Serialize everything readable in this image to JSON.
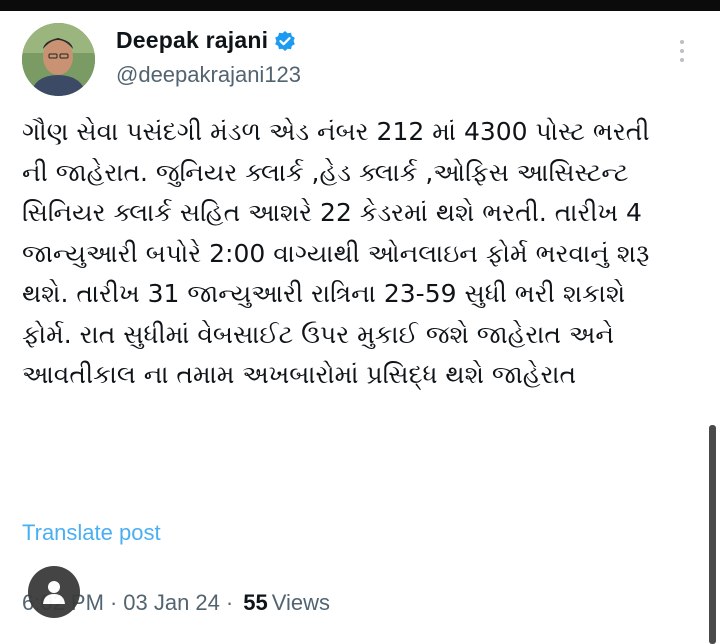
{
  "author": {
    "name": "Deepak rajani",
    "handle": "@deepakrajani123",
    "verified": true
  },
  "post": {
    "text": "ગૌણ સેવા પસંદગી મંડળ એડ નંબર 212 માં 4300 પોસ્ટ ભરતી ની જાહેરાત. જુનિયર ક્લાર્ક ,હેડ ક્લાર્ક ,ઓફિસ આસિસ્ટન્ટ સિનિયર ક્લાર્ક સહિત આશરે 22 કેડરમાં થશે ભરતી. તારીખ 4 જાન્યુઆરી બપોરે 2:00 વાગ્યાથી ઓનલાઇન ફોર્મ ભરવાનું શરૂ થશે. તારીખ 31 જાન્યુઆરી રાત્રિના 23-59 સુધી ભરી શકાશે ફોર્મ. રાત સુધીમાં વેબસાઈટ ઉપર મુકાઈ જશે જાહેરાત અને આવતીકાલ ના તમામ અખબારોમાં પ્રસિદ્ધ થશે જાહેરાત",
    "translate_label": "Translate post"
  },
  "meta": {
    "time": "6:02 PM",
    "separator": "·",
    "date": "03 Jan 24",
    "views_count": "55",
    "views_label": "Views"
  },
  "colors": {
    "accent": "#1d9bf0",
    "secondary_text": "#536471"
  }
}
